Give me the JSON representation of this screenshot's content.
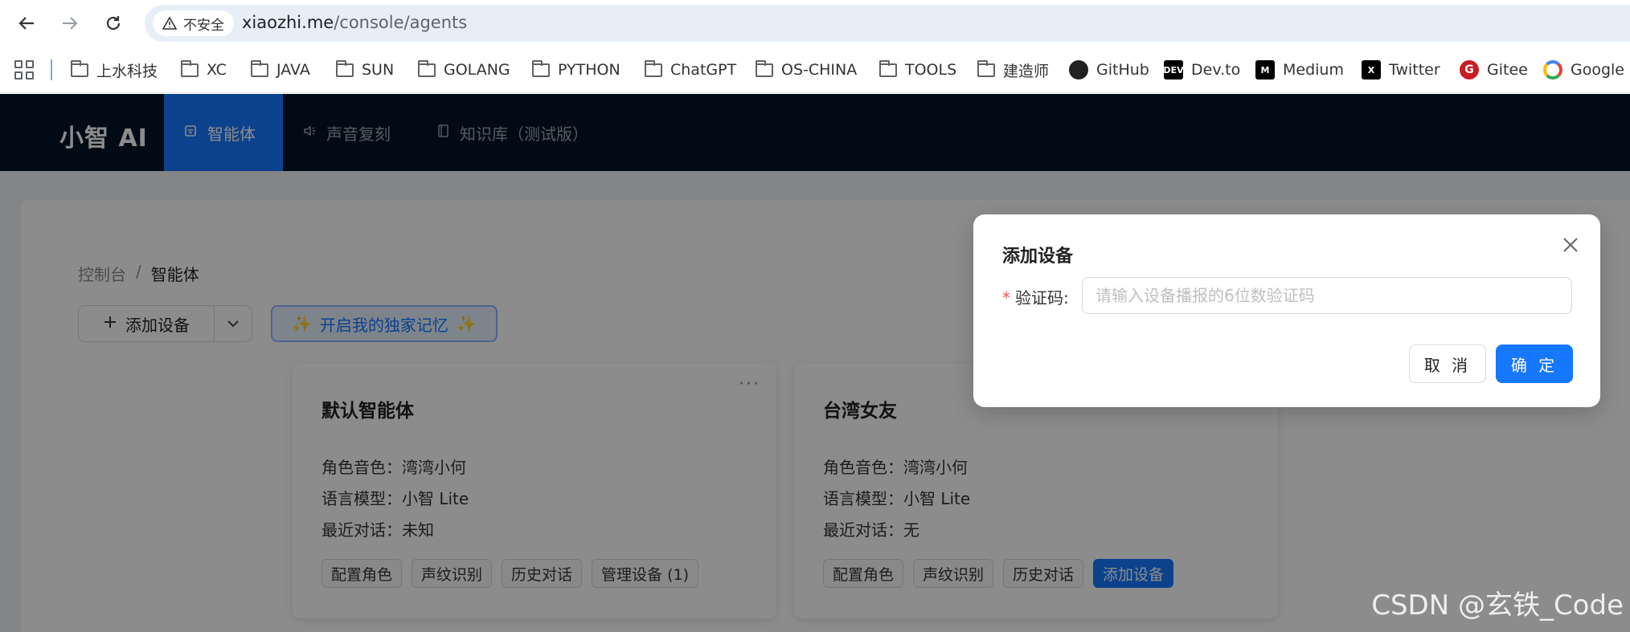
{
  "browser": {
    "security_label": "不安全",
    "url_host": "xiaozhi.me",
    "url_path": "/console/agents",
    "bookmarks": [
      {
        "label": "上水科技",
        "icon": "folder-icon"
      },
      {
        "label": "XC",
        "icon": "folder-icon"
      },
      {
        "label": "JAVA",
        "icon": "folder-icon"
      },
      {
        "label": "SUN",
        "icon": "folder-icon"
      },
      {
        "label": "GOLANG",
        "icon": "folder-icon"
      },
      {
        "label": "PYTHON",
        "icon": "folder-icon"
      },
      {
        "label": "ChatGPT",
        "icon": "folder-icon"
      },
      {
        "label": "OS-CHINA",
        "icon": "folder-icon"
      },
      {
        "label": "TOOLS",
        "icon": "folder-icon"
      },
      {
        "label": "建造师",
        "icon": "folder-icon"
      },
      {
        "label": "GitHub",
        "icon": "github-icon"
      },
      {
        "label": "Dev.to",
        "icon": "devto-icon"
      },
      {
        "label": "Medium",
        "icon": "medium-icon"
      },
      {
        "label": "Twitter",
        "icon": "x-icon"
      },
      {
        "label": "Gitee",
        "icon": "gitee-icon"
      },
      {
        "label": "Google",
        "icon": "google-icon"
      }
    ]
  },
  "header": {
    "brand": "小智 AI",
    "nav": [
      {
        "label": "智能体",
        "icon": "robot-icon",
        "active": true
      },
      {
        "label": "声音复刻",
        "icon": "speaker-icon",
        "active": false
      },
      {
        "label": "知识库（测试版）",
        "icon": "book-icon",
        "active": false
      }
    ]
  },
  "main": {
    "breadcrumb": [
      "控制台",
      "智能体"
    ],
    "breadcrumb_sep": "/",
    "add_device_label": "添加设备",
    "memory_label": "开启我的独家记忆",
    "agents": [
      {
        "name": "默认智能体",
        "voice_label": "角色音色：",
        "voice": "湾湾小何",
        "model_label": "语言模型：",
        "model": "小智 Lite",
        "recent_label": "最近对话：",
        "recent": "未知",
        "actions": [
          "配置角色",
          "声纹识别",
          "历史对话",
          "管理设备 (1)"
        ]
      },
      {
        "name": "台湾女友",
        "voice_label": "角色音色：",
        "voice": "湾湾小何",
        "model_label": "语言模型：",
        "model": "小智 Lite",
        "recent_label": "最近对话：",
        "recent": "无",
        "actions": [
          "配置角色",
          "声纹识别",
          "历史对话",
          "添加设备"
        ]
      }
    ]
  },
  "modal": {
    "title": "添加设备",
    "field_label": "验证码",
    "field_colon": ":",
    "input_value": "",
    "input_placeholder": "请输入设备播报的6位数验证码",
    "cancel_label": "取 消",
    "ok_label": "确 定"
  },
  "watermark": "CSDN @玄铁_Code",
  "colors": {
    "header_bg": "#001529",
    "accent": "#1677ff",
    "required": "#ff4d4f"
  }
}
